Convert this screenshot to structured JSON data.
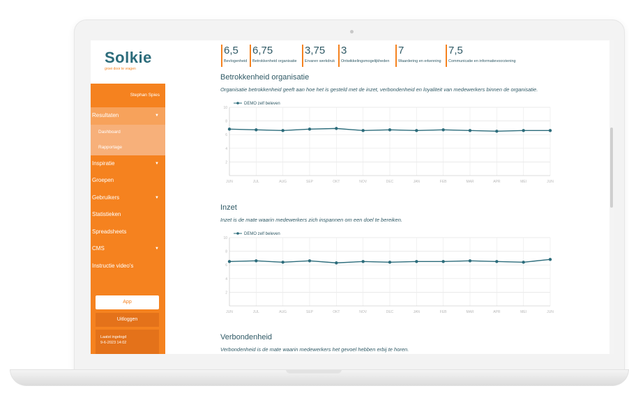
{
  "sidebar": {
    "logo": "Solkie",
    "tagline": "groei door te vragen",
    "user": "Stephan Spies",
    "items": [
      {
        "label": "Resultaten",
        "caret": "▼"
      },
      {
        "label": "Dashboard"
      },
      {
        "label": "Rapportage"
      },
      {
        "label": "Inspiratie",
        "caret": "▼"
      },
      {
        "label": "Groepen"
      },
      {
        "label": "Gebruikers",
        "caret": "▼"
      },
      {
        "label": "Statistieken"
      },
      {
        "label": "Spreadsheets"
      },
      {
        "label": "CMS",
        "caret": "▼"
      },
      {
        "label": "Instructie video's"
      }
    ],
    "app_button": "App",
    "logout_button": "Uitloggen",
    "last_login_label": "Laatst ingelogd",
    "last_login_value": "9-6-2023 14:02"
  },
  "scores": [
    {
      "value": "6,5",
      "label": "Bevlogenheid"
    },
    {
      "value": "6,75",
      "label": "Betrokkenheid organisatie"
    },
    {
      "value": "3,75",
      "label": "Ervaren werkdruk"
    },
    {
      "value": "3",
      "label": "Ontwikkelingsmogelijkheden"
    },
    {
      "value": "7",
      "label": "Waardering en erkenning"
    },
    {
      "value": "7,5",
      "label": "Communicatie en informatievoorziening"
    }
  ],
  "sections": [
    {
      "title": "Betrokkenheid organisatie",
      "description": "Organisatie betrokkenheid geeft aan hoe het is gesteld met de inzet, verbondenheid en loyaliteit van medewerkers binnen de organisatie."
    },
    {
      "title": "Inzet",
      "description": "Inzet is de mate waarin medewerkers zich inspannen om een doel te bereiken."
    },
    {
      "title": "Verbondenheid",
      "description": "Verbondenheid is de mate waarin medewerkers het gevoel hebben erbij te horen."
    }
  ],
  "colors": {
    "accent": "#f5821f",
    "line": "#2c6c7b",
    "text": "#2f5965"
  },
  "chart_data": [
    {
      "type": "line",
      "categories": [
        "JUN",
        "JUL",
        "AUG",
        "SEP",
        "OKT",
        "NOV",
        "DEC",
        "JAN",
        "FEB",
        "MAR",
        "APR",
        "MEI",
        "JUN"
      ],
      "series": [
        {
          "name": "DEMO zelf beleven",
          "values": [
            6.8,
            6.7,
            6.6,
            6.8,
            6.9,
            6.6,
            6.7,
            6.6,
            6.7,
            6.6,
            6.5,
            6.6,
            6.6
          ]
        }
      ],
      "ylim": [
        0,
        10
      ],
      "yticks": [
        "2",
        "4",
        "6",
        "8",
        "10"
      ],
      "legend": "top-left",
      "grid": true
    },
    {
      "type": "line",
      "categories": [
        "JUN",
        "JUL",
        "AUG",
        "SEP",
        "OKT",
        "NOV",
        "DEC",
        "JAN",
        "FEB",
        "MAR",
        "APR",
        "MEI",
        "JUN"
      ],
      "series": [
        {
          "name": "DEMO zelf beleven",
          "values": [
            6.5,
            6.6,
            6.4,
            6.6,
            6.3,
            6.5,
            6.4,
            6.5,
            6.5,
            6.6,
            6.5,
            6.4,
            6.8
          ]
        }
      ],
      "ylim": [
        0,
        10
      ],
      "yticks": [
        "2",
        "4",
        "6",
        "8",
        "10"
      ],
      "legend": "top-left",
      "grid": true
    }
  ]
}
